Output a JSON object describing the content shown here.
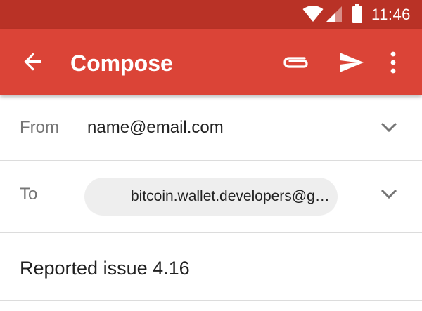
{
  "status_bar": {
    "time": "11:46",
    "icons": [
      "wifi-icon",
      "cell-signal-icon",
      "battery-icon"
    ]
  },
  "app_bar": {
    "title": "Compose",
    "color": "#db4437",
    "status_color": "#b93226",
    "actions": [
      "back-arrow-icon",
      "attach-icon",
      "send-icon",
      "more-vert-icon"
    ]
  },
  "form": {
    "from_label": "From",
    "from_value": "name@email.com",
    "to_label": "To",
    "to_chip": "bitcoin.wallet.developers@gmail.com",
    "subject": "Reported issue 4.16"
  }
}
